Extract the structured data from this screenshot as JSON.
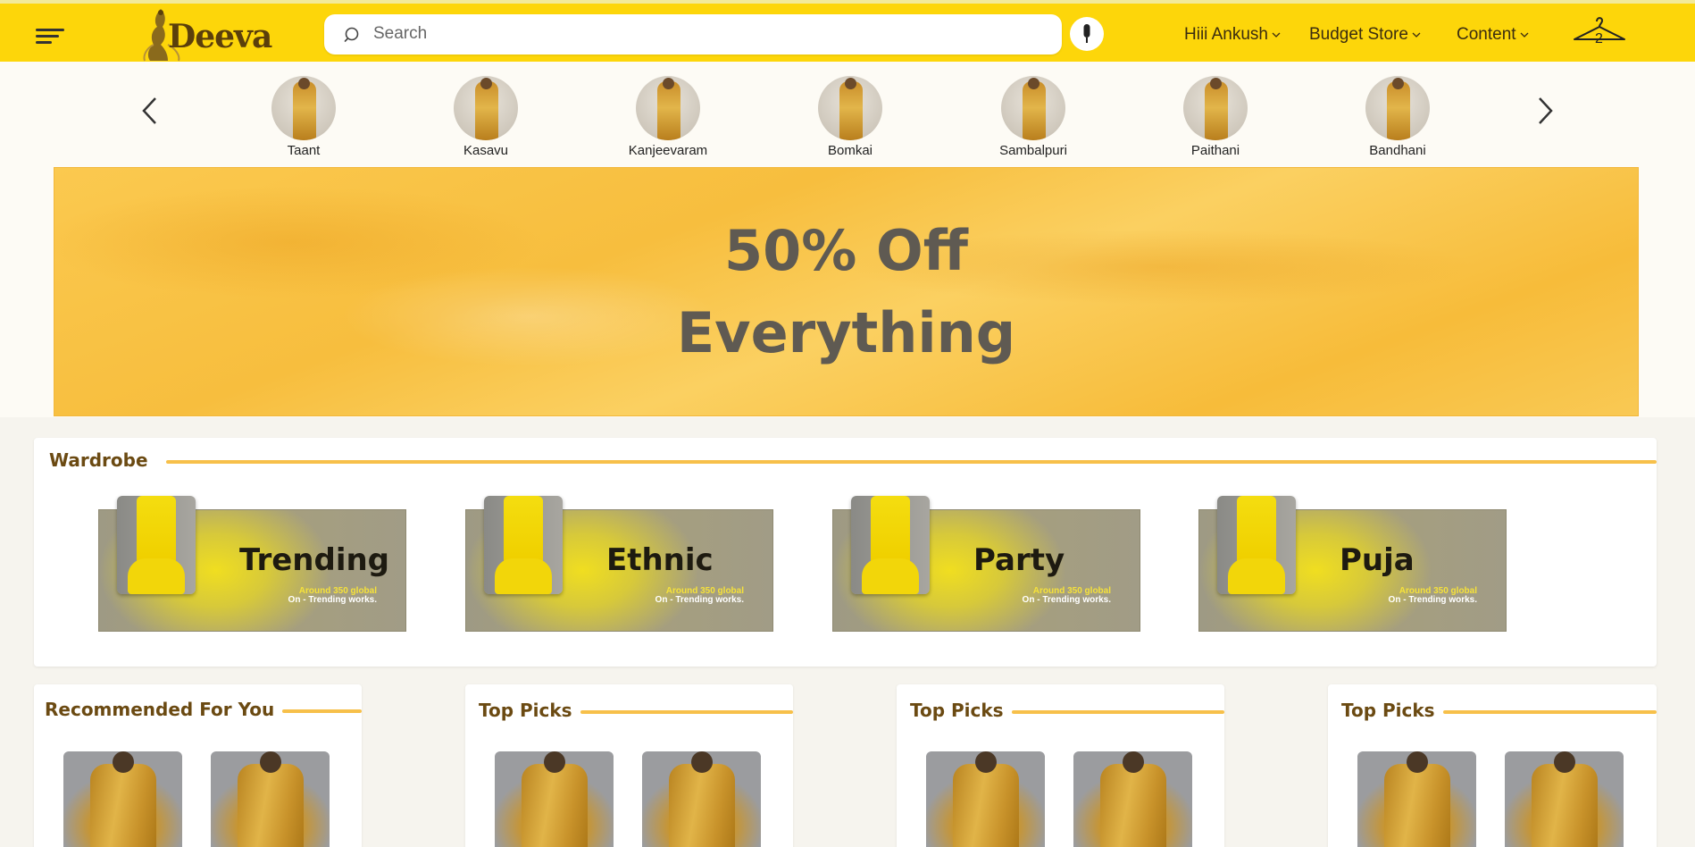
{
  "header": {
    "brand": "Deeva",
    "search_placeholder": "Search",
    "nav": [
      {
        "label": "Hiii Ankush"
      },
      {
        "label": "Budget Store"
      },
      {
        "label": "Content"
      }
    ],
    "cart_count": "2",
    "accent_color": "#fdd60a"
  },
  "categories": [
    {
      "label": "Taant"
    },
    {
      "label": "Kasavu"
    },
    {
      "label": "Kanjeevaram"
    },
    {
      "label": "Bomkai"
    },
    {
      "label": "Sambalpuri"
    },
    {
      "label": "Paithani"
    },
    {
      "label": "Bandhani"
    }
  ],
  "banner": {
    "line1": "50% Off",
    "line2": "Everything"
  },
  "wardrobe": {
    "title": "Wardrobe",
    "tiles": [
      {
        "label": "Trending",
        "sub1": "Around 350 global",
        "sub2": "On - Trending works."
      },
      {
        "label": "Ethnic",
        "sub1": "Around 350 global",
        "sub2": "On - Trending works."
      },
      {
        "label": "Party",
        "sub1": "Around 350 global",
        "sub2": "On - Trending works."
      },
      {
        "label": "Puja",
        "sub1": "Around 350 global",
        "sub2": "On - Trending works."
      }
    ]
  },
  "sections": [
    {
      "title": "Recommended For You"
    },
    {
      "title": "Top Picks"
    },
    {
      "title": "Top Picks"
    },
    {
      "title": "Top Picks"
    }
  ]
}
